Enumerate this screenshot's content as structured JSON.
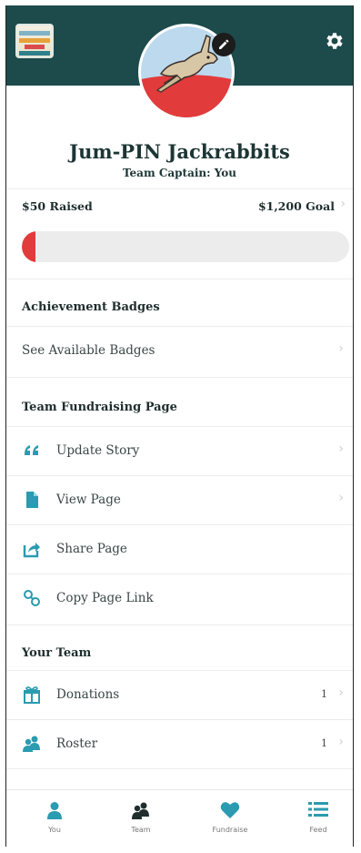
{
  "header": {
    "bg_color": "#1d4a4a",
    "logo_icon": "event-logo",
    "settings_icon": "gear-icon",
    "edit_icon": "pencil-icon"
  },
  "profile": {
    "team_name": "Jum-PIN Jackrabbits",
    "captain": "Team Captain: You",
    "avatar_icon": "jackrabbit-illustration"
  },
  "fundraising": {
    "raised": "$50 Raised",
    "goal": "$1,200 Goal",
    "progress_fraction": 0.042,
    "progress_color": "#e23b3b"
  },
  "badges": {
    "title": "Achievement Badges",
    "see_available": "See Available Badges"
  },
  "team_page": {
    "title": "Team Fundraising Page",
    "items": [
      {
        "label": "Update Story",
        "icon": "quote-icon",
        "chevron": true
      },
      {
        "label": "View Page",
        "icon": "document-icon",
        "chevron": true
      },
      {
        "label": "Share Page",
        "icon": "share-icon",
        "chevron": false
      },
      {
        "label": "Copy Page Link",
        "icon": "link-icon",
        "chevron": false
      }
    ]
  },
  "your_team": {
    "title": "Your Team",
    "items": [
      {
        "label": "Donations",
        "icon": "gift-icon",
        "count": "1"
      },
      {
        "label": "Roster",
        "icon": "people-icon",
        "count": "1"
      }
    ]
  },
  "nav": {
    "accent": "#2a9bb0",
    "items": [
      {
        "label": "You",
        "icon": "person-icon"
      },
      {
        "label": "Team",
        "icon": "team-icon"
      },
      {
        "label": "Fundraise",
        "icon": "heart-icon"
      },
      {
        "label": "Feed",
        "icon": "list-icon"
      }
    ]
  }
}
